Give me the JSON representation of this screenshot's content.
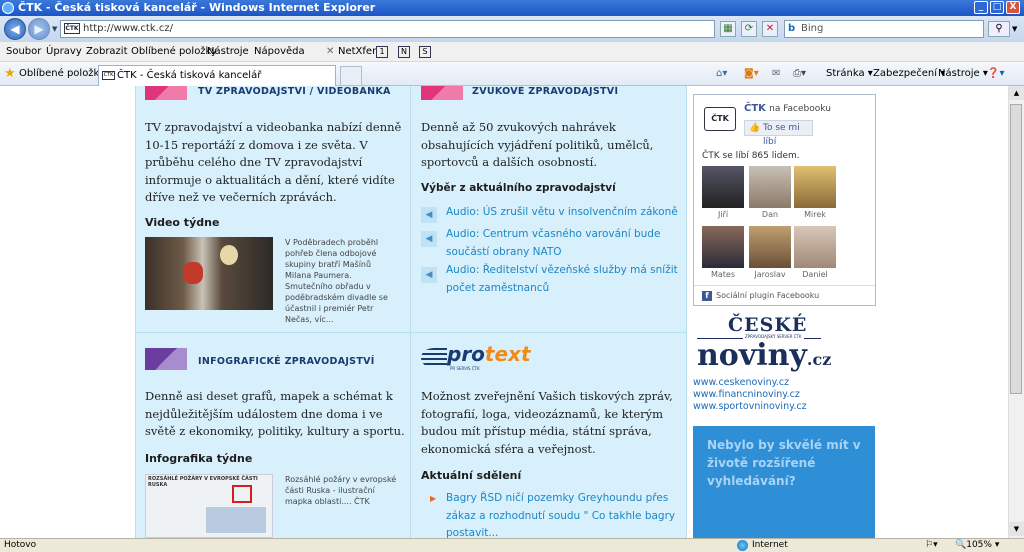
{
  "window": {
    "title": "ČTK - Česká tisková kancelář - Windows Internet Explorer",
    "minimize": "_",
    "maximize": "□",
    "close": "X"
  },
  "address": {
    "url": "http://www.ctk.cz/",
    "favicon": "ČTK"
  },
  "search": {
    "placeholder": "Bing"
  },
  "menu": [
    "Soubor",
    "Úpravy",
    "Zobrazit",
    "Oblíbené položky",
    "Nástroje",
    "Nápověda"
  ],
  "netxfer": "NetXfer",
  "favorites": {
    "label": "Oblíbené položky",
    "tab_title": "ČTK - Česká tisková kancelář"
  },
  "commandbar": {
    "page": "Stránka",
    "security": "Zabezpečení",
    "tools": "Nástroje"
  },
  "tv": {
    "title": "TV ZPRAVODAJSTVÍ / VIDEOBANKA",
    "text": "TV zpravodajství a videobanka nabízí denně 10-15 reportáží z domova i ze světa. V průběhu celého dne TV zpravodajství informuje o aktualitách a dění, které vidíte dříve než ve večerních zprávách.",
    "video_heading": "Video týdne",
    "video_caption": "V Poděbradech proběhl pohřeb člena odbojové skupiny bratří Mašínů Milana Paumera. Smutečního obřadu v poděbradském divadle se účastnil i premiér Petr Nečas, víc..."
  },
  "audio": {
    "title": "ZVUKOVÉ ZPRAVODAJSTVÍ",
    "text": "Denně až 50 zvukových nahrávek obsahujících vyjádření politiků, umělců, sportovců a dalších osobností.",
    "selection_heading": "Výběr z aktuálního zpravodajství",
    "items": [
      "Audio: ÚS zrušil větu v insolvenčním zákoně",
      "Audio: Centrum včasného varování bude součástí obrany NATO",
      "Audio: Ředitelství vězeňské služby má snížit počet zaměstnanců"
    ]
  },
  "infographic": {
    "title": "INFOGRAFICKÉ ZPRAVODAJSTVÍ",
    "text": "Denně asi deset grafů, mapek a schémat k nejdůležitějším událostem dne doma i ve světě z ekonomiky, politiky, kultury a sportu.",
    "week_heading": "Infografika týdne",
    "thumb_title": "ROZSÁHLÉ POŽÁRY V EVROPSKÉ ČÁSTI RUSKA",
    "caption": "Rozsáhlé požáry v evropské části Ruska - ilustrační mapka oblasti.... ČTK"
  },
  "protext": {
    "logo_a": "pro",
    "logo_b": "text",
    "logo_sub": "PR SERVIS ČTK",
    "text": "Možnost zveřejnění Vašich tiskových zpráv, fotografií, loga, videozáznamů, ke kterým budou mít přístup média, státní správa, ekonomická sféra a veřejnost.",
    "news_heading": "Aktuální sdělení",
    "news_item": "Bagry ŘSD ničí pozemky Greyhoundu přes zákaz a rozhodnutí soudu \" Co takhle bagry postavit..."
  },
  "facebook": {
    "name": "ČTK",
    "on": "na Facebooku",
    "like": "To se mi líbí",
    "count_text": "ČTK se líbí 865 lidem.",
    "people": [
      "Jiří",
      "Dan",
      "Mirek",
      "Mates",
      "Jaroslav",
      "Daniel"
    ],
    "plugin": "Sociální plugin Facebooku"
  },
  "ceskenoviny": {
    "top": "ČESKÉ",
    "mid": "ZPRAVODAJSKÝ SERVER ČTK",
    "bottom": "noviny",
    "cz": ".cz",
    "links": [
      "www.ceskenoviny.cz",
      "www.financninoviny.cz",
      "www.sportovninoviny.cz"
    ]
  },
  "ad": {
    "text": "Nebylo by skvělé mít v životě rozšířené vyhledávání?"
  },
  "status": {
    "left": "Hotovo",
    "zone": "Internet",
    "zoom": "105%"
  },
  "colors": {
    "panel": "#d8f0fb",
    "title": "#1a3b72",
    "link": "#1a87c8",
    "accent": "#e0357a",
    "ad": "#2f8fd6"
  }
}
